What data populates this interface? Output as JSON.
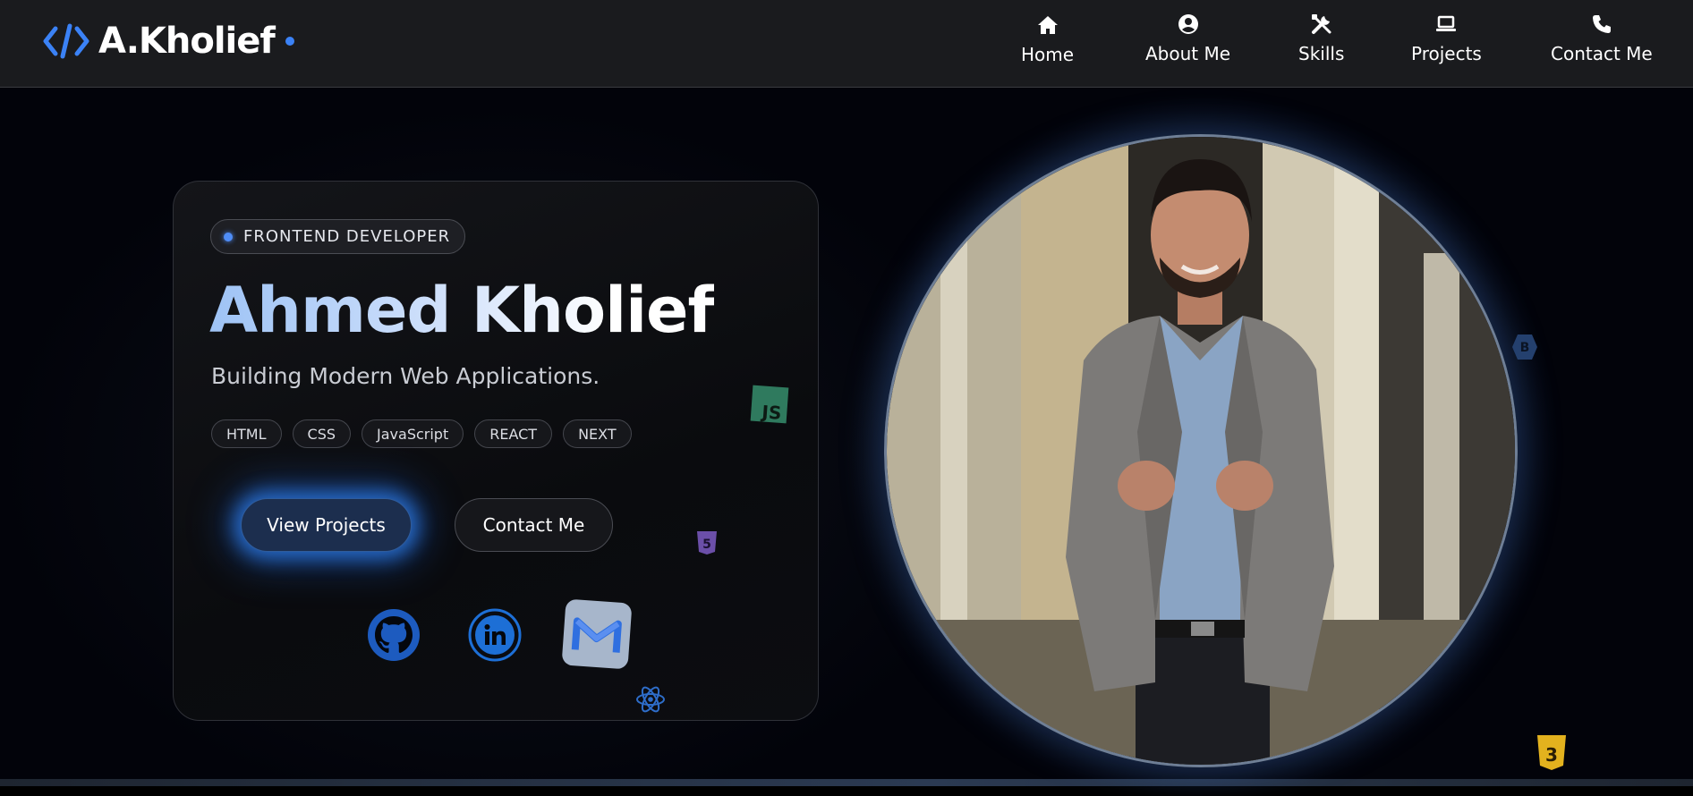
{
  "brand": {
    "logo_text": "A.Kholief",
    "logo_icon": "code-icon",
    "accent_color": "#3b82f6"
  },
  "nav": {
    "items": [
      {
        "label": "Home",
        "icon": "home-icon"
      },
      {
        "label": "About Me",
        "icon": "user-circle-icon"
      },
      {
        "label": "Skills",
        "icon": "tools-icon"
      },
      {
        "label": "Projects",
        "icon": "laptop-icon"
      },
      {
        "label": "Contact Me",
        "icon": "phone-icon"
      }
    ]
  },
  "hero": {
    "role_badge": "FRONTEND DEVELOPER",
    "name": "Ahmed Kholief",
    "tagline": "Building Modern Web Applications.",
    "tech_tags": [
      "HTML",
      "CSS",
      "JavaScript",
      "REACT",
      "NEXT"
    ],
    "primary_button": "View Projects",
    "secondary_button": "Contact Me",
    "socials": [
      {
        "name": "GitHub",
        "icon": "github-icon"
      },
      {
        "name": "LinkedIn",
        "icon": "linkedin-icon"
      },
      {
        "name": "Gmail",
        "icon": "gmail-icon"
      }
    ]
  },
  "floating_icons": {
    "js_badge": "JS",
    "html5_badge": "5",
    "css3_badge": "3",
    "bootstrap_badge": "B"
  },
  "colors": {
    "nav_bg": "#1a1b1e",
    "name_gradient_start": "#9ec3f5",
    "primary_button_bg": "#1c2e4e",
    "glow": "#2d7deb"
  }
}
